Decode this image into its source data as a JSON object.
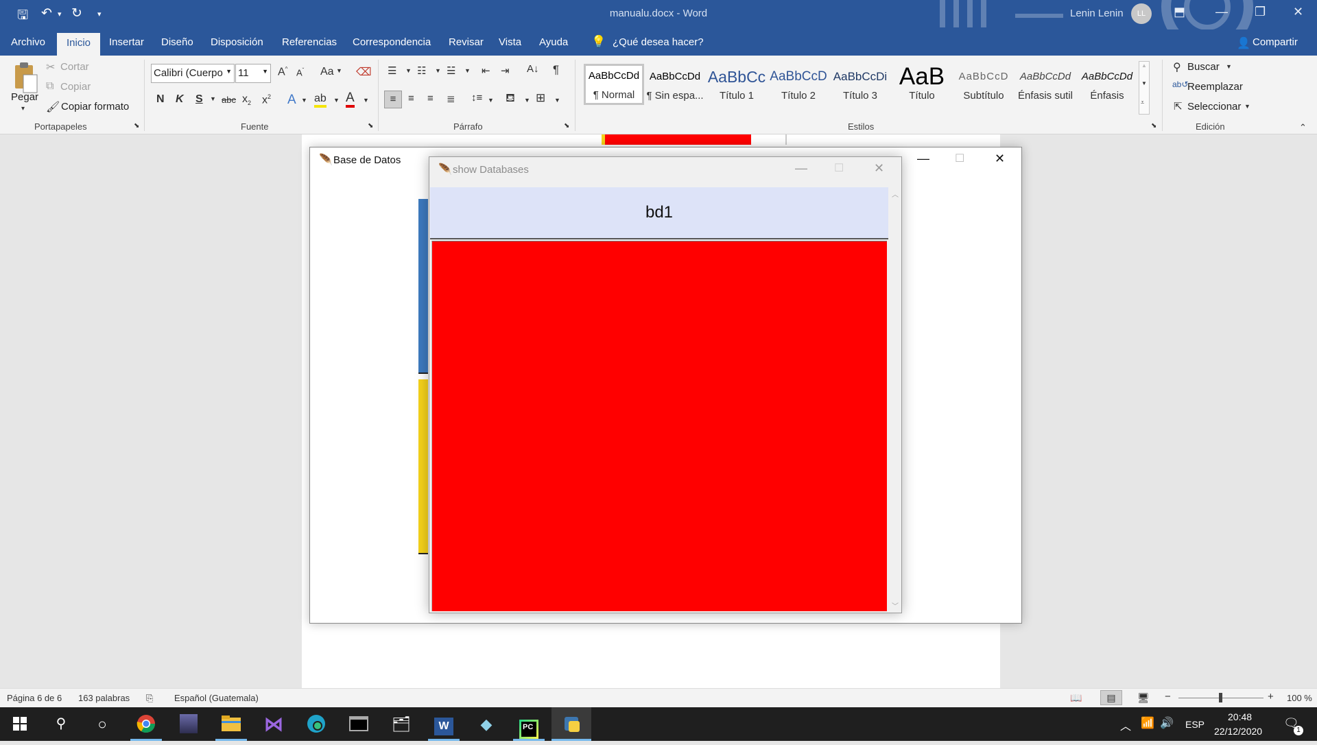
{
  "window": {
    "doc_title": "manualu.docx",
    "title_sep": "-",
    "app_name": "Word",
    "user_name": "Lenin Lenin",
    "user_initials": "LL"
  },
  "menu": {
    "tabs": [
      "Archivo",
      "Inicio",
      "Insertar",
      "Diseño",
      "Disposición",
      "Referencias",
      "Correspondencia",
      "Revisar",
      "Vista",
      "Ayuda"
    ],
    "active_tab": "Inicio",
    "tell_me": "¿Qué desea hacer?",
    "share": "Compartir"
  },
  "ribbon": {
    "clipboard": {
      "paste": "Pegar",
      "cut": "Cortar",
      "copy": "Copiar",
      "format_painter": "Copiar formato",
      "label": "Portapapeles"
    },
    "font": {
      "family": "Calibri (Cuerpo",
      "size": "11",
      "case_btn": "Aa",
      "bold": "N",
      "italic": "K",
      "underline": "S",
      "strike": "abc",
      "label": "Fuente"
    },
    "paragraph": {
      "label": "Párrafo"
    },
    "styles": {
      "items": [
        {
          "preview": "AaBbCcDd",
          "label": "¶ Normal"
        },
        {
          "preview": "AaBbCcDd",
          "label": "¶ Sin espa..."
        },
        {
          "preview": "AaBbCc",
          "label": "Título 1"
        },
        {
          "preview": "AaBbCcD",
          "label": "Título 2"
        },
        {
          "preview": "AaBbCcDi",
          "label": "Título 3"
        },
        {
          "preview": "AaB",
          "label": "Título"
        },
        {
          "preview": "AaBbCcD",
          "label": "Subtítulo"
        },
        {
          "preview": "AaBbCcDd",
          "label": "Énfasis sutil"
        },
        {
          "preview": "AaBbCcDd",
          "label": "Énfasis"
        }
      ],
      "label": "Estilos"
    },
    "editing": {
      "find": "Buscar",
      "replace": "Reemplazar",
      "select": "Seleccionar",
      "label": "Edición"
    }
  },
  "bd_window": {
    "title": "Base de Datos"
  },
  "show_db_window": {
    "title": "show Databases",
    "header": "bd1"
  },
  "status": {
    "page": "Página 6 de 6",
    "words": "163 palabras",
    "language": "Español (Guatemala)",
    "zoom": "100 %"
  },
  "taskbar": {
    "lang": "ESP",
    "time": "20:48",
    "date": "22/12/2020",
    "notifications": "1"
  },
  "colors": {
    "word_blue": "#2b579a",
    "red_panel": "#ff0000",
    "header_bg": "#dde3f8",
    "blue_bar": "#3d7abf",
    "yellow_bar": "#f5d21a"
  }
}
